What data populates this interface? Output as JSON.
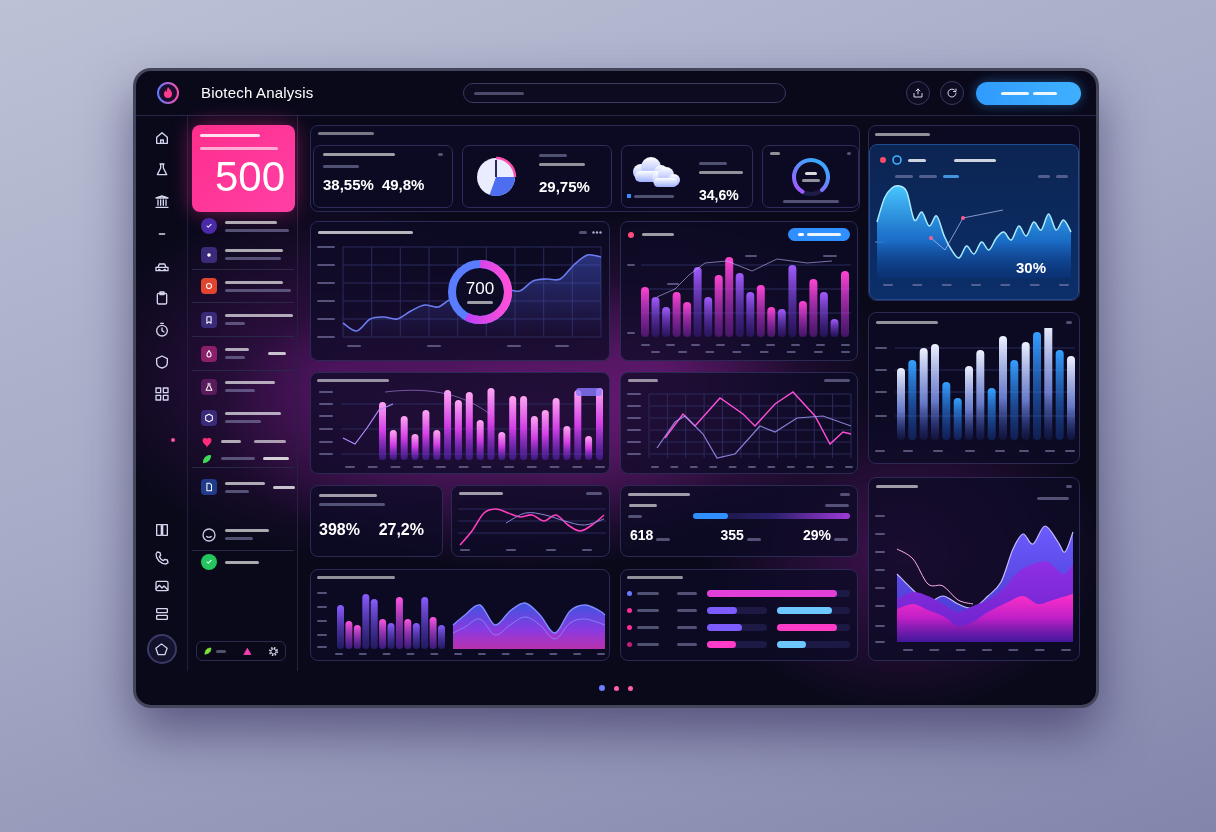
{
  "header": {
    "title": "Biotech Analysis"
  },
  "highlight_card": {
    "value": "500"
  },
  "overview": {
    "cards": [
      {
        "kind": "dual",
        "values": [
          "38,55%",
          "49,8%"
        ]
      },
      {
        "kind": "pie",
        "value": "29,75%"
      },
      {
        "kind": "weather",
        "value": "34,6%"
      },
      {
        "kind": "gauge"
      }
    ]
  },
  "trend_panel": {
    "center_value": "700"
  },
  "right_area_panel": {
    "value": "30%"
  },
  "split_stat": {
    "values": [
      "398%",
      "27,2%"
    ]
  },
  "progress_panel": {
    "level": 0.22,
    "stats": [
      "618",
      "355",
      "29%"
    ]
  },
  "comparison_panel": {
    "rows": [
      {
        "color": "#6b7bff",
        "bars": [
          {
            "level": 0.91,
            "color": "#e23fd8"
          }
        ]
      },
      {
        "color": "#ff2d95",
        "bars": [
          {
            "level": 0.5,
            "color": "#7d5cff"
          },
          {
            "level": 0.75,
            "color": "#6cc8ff"
          }
        ]
      },
      {
        "color": "#ff2d95",
        "bars": [
          {
            "level": 0.58,
            "color": "#7d5cff"
          },
          {
            "level": 0.82,
            "color": "#ff3cc8"
          }
        ]
      },
      {
        "color": "#c21d79",
        "bars": [
          {
            "level": 0.48,
            "color": "#ff3cc8"
          },
          {
            "level": 0.4,
            "color": "#6cc8ff"
          }
        ]
      }
    ]
  },
  "page_dots": [
    {
      "selected": true
    },
    {
      "selected": false
    },
    {
      "selected": false
    }
  ]
}
